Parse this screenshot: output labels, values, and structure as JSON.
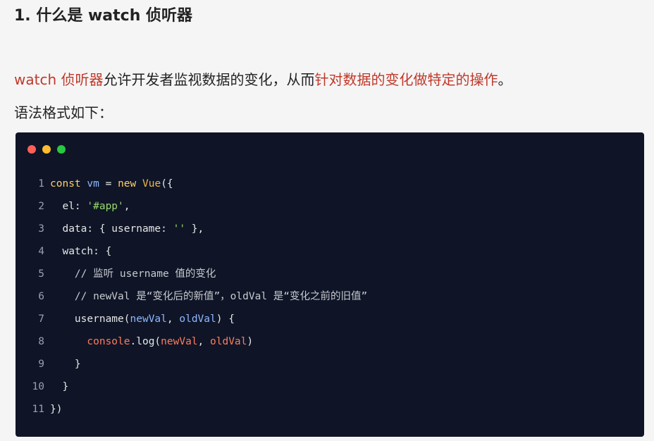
{
  "heading": "1. 什么是 watch 侦听器",
  "paragraph": {
    "part1": "watch 侦听器",
    "part2": "允许开发者监视数据的变化，从而",
    "part3": "针对数据的变化做特定的操作",
    "part4": "。"
  },
  "syntax_label": "语法格式如下：",
  "window_dots": {
    "red": "#ff5f57",
    "yellow": "#febc2e",
    "green": "#28c840"
  },
  "code": {
    "lines": [
      {
        "num": "1",
        "t": [
          [
            "kw",
            "const"
          ],
          [
            "plain",
            " "
          ],
          [
            "var",
            "vm"
          ],
          [
            "plain",
            " = "
          ],
          [
            "kw",
            "new"
          ],
          [
            "plain",
            " "
          ],
          [
            "cls",
            "Vue"
          ],
          [
            "plain",
            "({"
          ]
        ]
      },
      {
        "num": "2",
        "t": [
          [
            "plain",
            "  el: "
          ],
          [
            "str",
            "'#app'"
          ],
          [
            "plain",
            ","
          ]
        ]
      },
      {
        "num": "3",
        "t": [
          [
            "plain",
            "  data: { username: "
          ],
          [
            "str",
            "''"
          ],
          [
            "plain",
            " },"
          ]
        ]
      },
      {
        "num": "4",
        "t": [
          [
            "plain",
            "  watch: {"
          ]
        ]
      },
      {
        "num": "5",
        "t": [
          [
            "cm",
            "    // 监听 username 值的变化"
          ]
        ]
      },
      {
        "num": "6",
        "t": [
          [
            "cm",
            "    // newVal 是“变化后的新值”，oldVal 是“变化之前的旧值”"
          ]
        ]
      },
      {
        "num": "7",
        "t": [
          [
            "plain",
            "    username("
          ],
          [
            "var",
            "newVal"
          ],
          [
            "plain",
            ", "
          ],
          [
            "var",
            "oldVal"
          ],
          [
            "plain",
            ") {"
          ]
        ]
      },
      {
        "num": "8",
        "t": [
          [
            "plain",
            "      "
          ],
          [
            "fn",
            "console"
          ],
          [
            "plain",
            ".log("
          ],
          [
            "param",
            "newVal"
          ],
          [
            "plain",
            ", "
          ],
          [
            "param",
            "oldVal"
          ],
          [
            "plain",
            ")"
          ]
        ]
      },
      {
        "num": "9",
        "t": [
          [
            "plain",
            "    }"
          ]
        ]
      },
      {
        "num": "10",
        "t": [
          [
            "plain",
            "  }"
          ]
        ]
      },
      {
        "num": "11",
        "t": [
          [
            "plain",
            "})"
          ]
        ]
      }
    ]
  }
}
